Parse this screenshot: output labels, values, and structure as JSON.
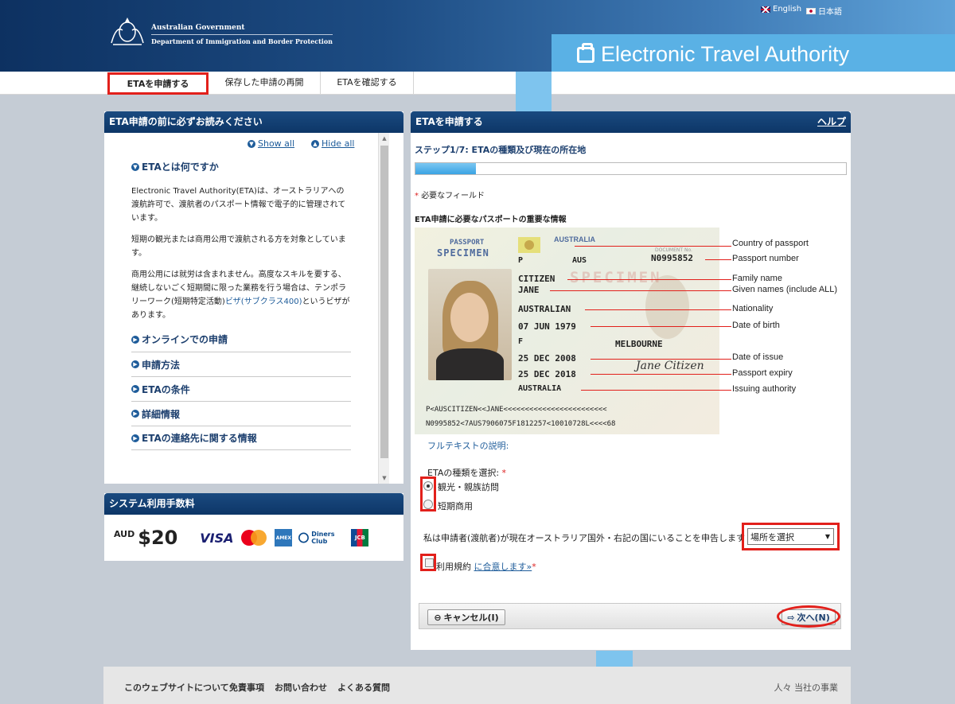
{
  "header": {
    "gov_line1": "Australian Government",
    "gov_line2": "Department of Immigration and Border Protection",
    "app_title": "Electronic Travel Authority",
    "lang_en": "English",
    "lang_ja": "日本語"
  },
  "nav": {
    "items": [
      {
        "label": "ETAを申請する"
      },
      {
        "label": "保存した申請の再開"
      },
      {
        "label": "ETAを確認する"
      }
    ]
  },
  "left_panel": {
    "title": "ETA申請の前に必ずお読みください",
    "show_all": "Show all",
    "hide_all": "Hide all",
    "section_title": "ETAとは何ですか",
    "para1": "Electronic Travel Authority(ETA)は、オーストラリアへの渡航許可で、渡航者のパスポート情報で電子的に管理されています。",
    "para2": "短期の観光または商用公用で渡航される方を対象としています。",
    "para3_prefix": "商用公用には就労は含まれません。高度なスキルを要する、継続しないごく短期間に限った業務を行う場合は、テンポラリーワーク(短期特定活動)",
    "para3_link": "ビザ(サブクラス400)",
    "para3_suffix": "というビザがあります。",
    "accordion": [
      {
        "label": "オンラインでの申請"
      },
      {
        "label": "申請方法"
      },
      {
        "label": "ETAの条件"
      },
      {
        "label": "詳細情報"
      },
      {
        "label": "ETAの連絡先に関する情報"
      }
    ]
  },
  "fee_panel": {
    "title": "システム利用手数料",
    "currency": "AUD",
    "price": "$20",
    "cards": [
      "VISA",
      "MasterCard",
      "American Express",
      "Diners Club",
      "JCB"
    ]
  },
  "right_panel": {
    "title": "ETAを申請する",
    "help": "ヘルプ",
    "step": "ステップ1/7: ETAの種類及び現在の所在地",
    "progress": 0.14,
    "required_note": "必要なフィールド",
    "required_mark": "*",
    "passport_title": "ETA申請に必要なパスポートの重要な情報",
    "passport": {
      "passport_word": "PASSPORT",
      "specimen": "SPECIMEN",
      "country_word": "AUSTRALIA",
      "type": "P",
      "code": "AUS",
      "doc_no_label": "DOCUMENT No.",
      "doc_no": "N0995852",
      "surname": "CITIZEN",
      "given": "JANE",
      "nationality": "AUSTRALIAN",
      "dob": "07 JUN 1979",
      "sex": "F",
      "birthplace": "MELBOURNE",
      "issue": "25 DEC 2008",
      "expiry": "25 DEC 2018",
      "authority": "AUSTRALIA",
      "signature": "Jane Citizen",
      "mrz1": "P<AUSCITIZEN<<JANE<<<<<<<<<<<<<<<<<<<<<<<<",
      "mrz2": "N0995852<7AUS7906075F1812257<10010728L<<<<68"
    },
    "callouts": [
      {
        "label": "Country of passport"
      },
      {
        "label": "Passport number"
      },
      {
        "label": "Family name"
      },
      {
        "label": "Given names (include ALL)"
      },
      {
        "label": "Nationality"
      },
      {
        "label": "Date of birth"
      },
      {
        "label": "Date of issue"
      },
      {
        "label": "Passport expiry"
      },
      {
        "label": "Issuing authority"
      }
    ],
    "fulltext_link": "フルテキストの説明:",
    "eta_type_label": "ETAの種類を選択:",
    "radio_options": [
      {
        "label": "観光・親族訪問",
        "selected": true
      },
      {
        "label": "短期商用",
        "selected": false
      }
    ],
    "declare_text": "私は申請者(渡航者)が現在オーストラリア国外・右記の国にいることを申告します",
    "location_select": "場所を選択",
    "terms_prefix": "利用規約",
    "terms_link": "に合意します»",
    "cancel_button": "キャンセル(I)",
    "next_button": "次へ(N)"
  },
  "footer": {
    "links": [
      {
        "label": "このウェブサイトについて"
      },
      {
        "label": "免責事項"
      },
      {
        "label": "お問い合わせ"
      },
      {
        "label": "よくある質問"
      }
    ],
    "right": "人々 当社の事業"
  }
}
